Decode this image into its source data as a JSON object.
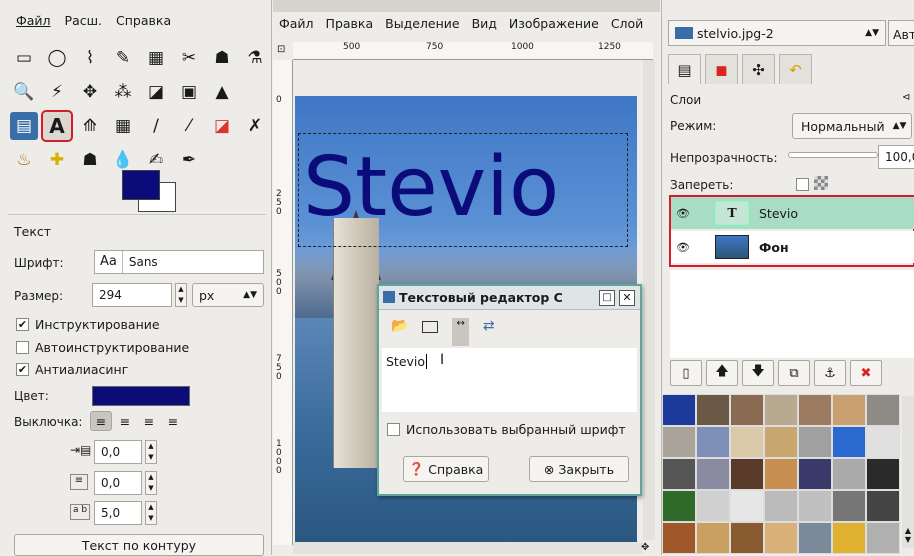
{
  "toolbox": {
    "menu": [
      "Файл",
      "Расш.",
      "Справка"
    ],
    "tools": [
      [
        "▭",
        "◯",
        "⌇",
        "✎",
        "▦",
        "✂",
        "☗",
        "⚗"
      ],
      [
        "🔍",
        "⚡",
        "✥",
        "⁂",
        "◪",
        "▣",
        "▲"
      ],
      [
        "▤",
        "A",
        "⟰",
        "▦",
        "∕",
        "⁄",
        "◪",
        "✗"
      ],
      [
        "♨",
        "✚",
        "☗",
        "💧",
        "✍",
        "✒"
      ]
    ],
    "options_title": "Текст",
    "font_label": "Шрифт:",
    "font_preview": "Aa",
    "font_value": "Sans",
    "size_label": "Размер:",
    "size_value": "294",
    "size_unit": "px",
    "hinting_label": "Инструктирование",
    "autohint_label": "Автоинструктирование",
    "antialias_label": "Антиалиасинг",
    "color_label": "Цвет:",
    "justify_label": "Выключка:",
    "indent_value": "0,0",
    "line_spacing_value": "0,0",
    "letter_spacing_value": "5,0",
    "path_button": "Текст по контуру",
    "text_color": "#0b0c7a",
    "accent": "#d21e2b"
  },
  "image_window": {
    "menu": [
      "Файл",
      "Правка",
      "Выделение",
      "Вид",
      "Изображение",
      "Слой"
    ],
    "ruler_marks": [
      "500",
      "750",
      "1000",
      "1250"
    ],
    "vruler_marks": [
      "0",
      "250",
      "500",
      "750",
      "1000"
    ],
    "canvas_text": "Stevio"
  },
  "text_editor": {
    "title": "Текстовый редактор С",
    "content": "Stevio",
    "use_font_label": "Использовать выбранный шрифт",
    "help_button": "Справка",
    "close_button": "Закрыть"
  },
  "layers_panel": {
    "image_name": "stelvio.jpg-2",
    "auto_label": "Авто",
    "section_title": "Слои",
    "mode_label": "Режим:",
    "mode_value": "Нормальный",
    "opacity_label": "Непрозрачность:",
    "opacity_value": "100,0",
    "lock_label": "Запереть:",
    "layers": [
      {
        "name": "Stevio",
        "type": "text"
      },
      {
        "name": "Фон",
        "type": "image"
      }
    ]
  }
}
